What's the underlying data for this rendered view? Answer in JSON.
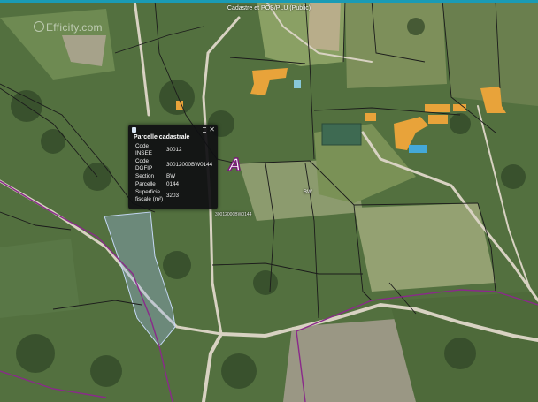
{
  "map": {
    "layer_title": "Cadastre et POS/PLU (Public)",
    "watermark": "Efficity.com",
    "marker_letter": "A",
    "section_label": "BW",
    "parcel_label": "30012000BW0144"
  },
  "popup": {
    "title": "Parcelle cadastrale",
    "rows": [
      {
        "label": "Code\nINSEE",
        "value": "30012"
      },
      {
        "label": "Code\nDGFIP",
        "value": "30012000BW0144"
      },
      {
        "label": "Section",
        "value": "BW"
      },
      {
        "label": "Parcelle",
        "value": "0144"
      },
      {
        "label": "Superficie\nfiscale (m²)",
        "value": "3203"
      }
    ],
    "close_symbol": "✕"
  },
  "colors": {
    "parcel_border": "#1b1b1b",
    "commune_border": "#8a2a8a",
    "highlight_fill": "#9ab8e8",
    "road": "#d8d2c2",
    "popup_bg": "#0f0f12"
  }
}
